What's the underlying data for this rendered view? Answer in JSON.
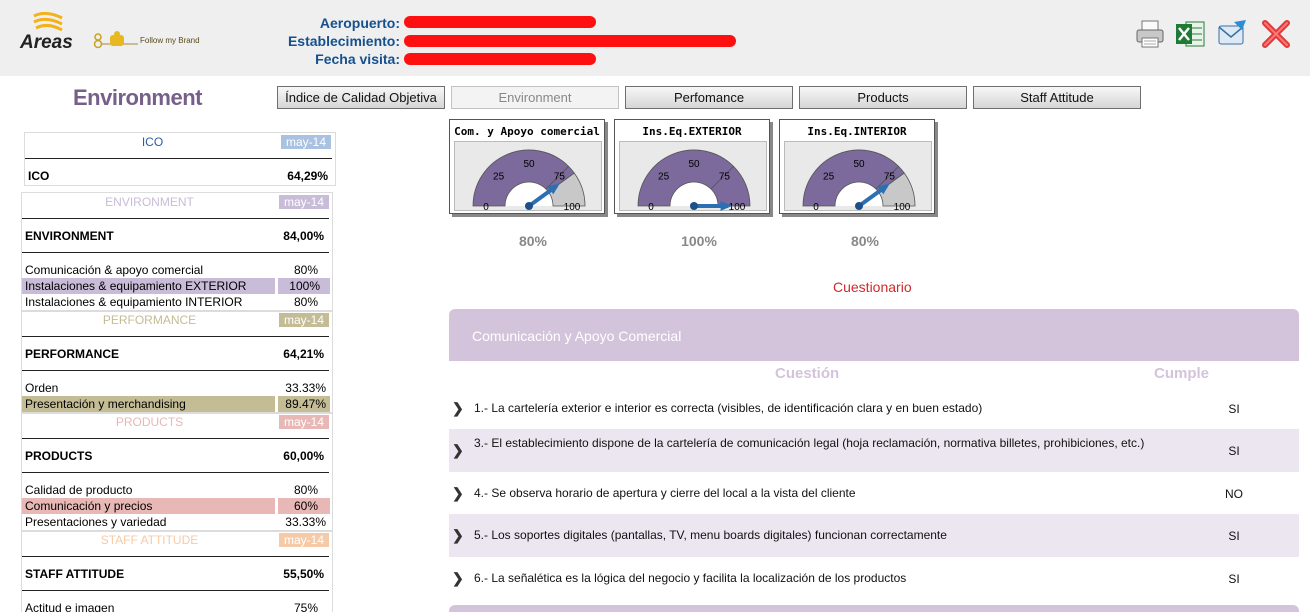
{
  "header": {
    "logo_text": "Areas",
    "brand_text": "Follow my Brand",
    "aeropuerto_label": "Aeropuerto:",
    "establecimiento_label": "Establecimiento:",
    "fecha_label": "Fecha visita:"
  },
  "page_title": "Environment",
  "tabs": [
    {
      "label": "Índice de Calidad Objetiva"
    },
    {
      "label": "Environment"
    },
    {
      "label": "Perfomance"
    },
    {
      "label": "Products"
    },
    {
      "label": "Staff Attitude"
    }
  ],
  "summary": {
    "ico": {
      "header": "ICO",
      "date": "may-14",
      "total_label": "ICO",
      "total_value": "64,29%"
    },
    "environment": {
      "header": "ENVIRONMENT",
      "date": "may-14",
      "total_label": "ENVIRONMENT",
      "total_value": "84,00%",
      "items": [
        {
          "label": "Comunicación & apoyo comercial",
          "value": "80%"
        },
        {
          "label": "Instalaciones & equipamiento EXTERIOR",
          "value": "100%"
        },
        {
          "label": "Instalaciones & equipamiento INTERIOR",
          "value": "80%"
        }
      ]
    },
    "performance": {
      "header": "PERFORMANCE",
      "date": "may-14",
      "total_label": "PERFORMANCE",
      "total_value": "64,21%",
      "items": [
        {
          "label": "Orden",
          "value": "33.33%"
        },
        {
          "label": "Presentación y merchandising",
          "value": "89.47%"
        }
      ]
    },
    "products": {
      "header": "PRODUCTS",
      "date": "may-14",
      "total_label": "PRODUCTS",
      "total_value": "60,00%",
      "items": [
        {
          "label": "Calidad de producto",
          "value": "80%"
        },
        {
          "label": "Comunicación y precios",
          "value": "60%"
        },
        {
          "label": "Presentaciones y variedad",
          "value": "33.33%"
        }
      ]
    },
    "staff": {
      "header": "STAFF ATTITUDE",
      "date": "may-14",
      "total_label": "STAFF ATTITUDE",
      "total_value": "55,50%",
      "items": [
        {
          "label": "Actitud e imagen",
          "value": "75%"
        }
      ]
    }
  },
  "gauges": [
    {
      "title": "Com. y Apoyo comercial",
      "value": 80,
      "value_label": "80%"
    },
    {
      "title": "Ins.Eq.EXTERIOR",
      "value": 100,
      "value_label": "100%"
    },
    {
      "title": "Ins.Eq.INTERIOR",
      "value": 80,
      "value_label": "80%"
    }
  ],
  "gauge_ticks": [
    "0",
    "25",
    "50",
    "75",
    "100"
  ],
  "cuestionario": {
    "title": "Cuestionario",
    "section": "Comunicación y Apoyo Comercial",
    "col_question": "Cuestión",
    "col_answer": "Cumple",
    "questions": [
      {
        "text": "1.- La cartelería exterior e interior es correcta (visibles, de identificación clara y en buen estado)",
        "answer": "SI"
      },
      {
        "text": "3.- El establecimiento dispone de la cartelería de comunicación legal (hoja reclamación, normativa billetes, prohibiciones, etc.)",
        "answer": "SI"
      },
      {
        "text": "4.- Se observa horario de apertura y cierre del local a la vista del cliente",
        "answer": "NO"
      },
      {
        "text": "5.- Los soportes digitales (pantallas, TV, menu boards digitales) funcionan correctamente",
        "answer": "SI"
      },
      {
        "text": "6.- La señalética es la lógica del negocio y facilita la localización de los productos",
        "answer": "SI"
      }
    ]
  },
  "colors": {
    "environment": "#c9bcd8",
    "performance": "#c4bc94",
    "products": "#e8b8b6",
    "staff": "#f6caa6",
    "ico": "#a9c2e2",
    "gauge_fill": "#7b6a9b",
    "section_head": "#d3c4dc"
  }
}
